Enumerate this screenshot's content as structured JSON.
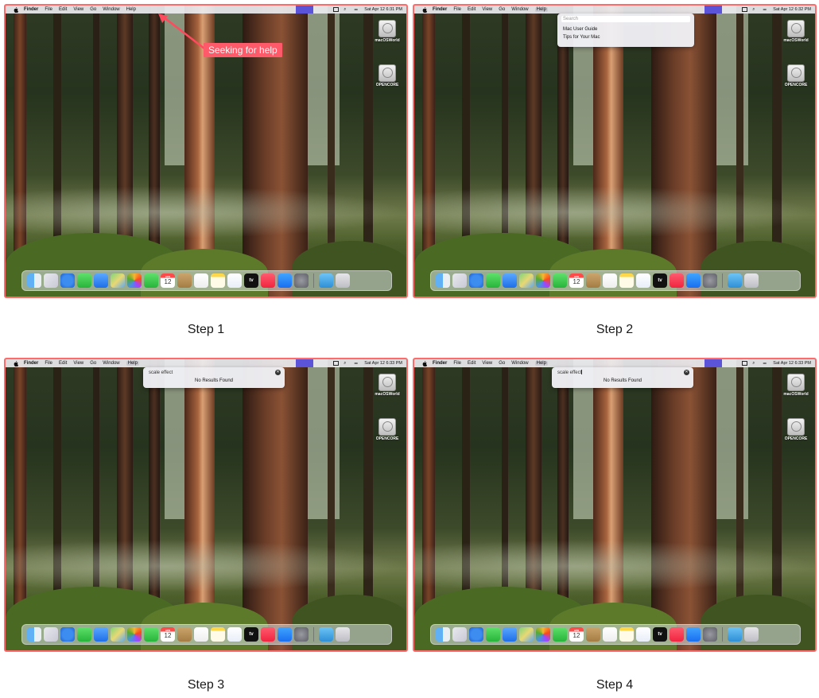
{
  "menubar": {
    "app": "Finder",
    "items": [
      "File",
      "Edit",
      "View",
      "Go",
      "Window",
      "Help"
    ]
  },
  "clock": {
    "step1": "Sat Apr 12  6:31 PM",
    "step2": "Sat Apr 12  6:32 PM",
    "step3": "Sat Apr 12  6:33 PM",
    "step4": "Sat Apr 12  6:33 PM"
  },
  "desktop_icons": [
    "macOSWorld",
    "OPENCORE"
  ],
  "annotation": "Seeking for help",
  "help_menu": {
    "search_placeholder": "Search",
    "items": [
      "Mac User Guide",
      "Tips for Your Mac"
    ],
    "query": "scale effect",
    "no_results": "No Results Found"
  },
  "dock": {
    "icons": [
      "finder-icon",
      "launchpad-icon",
      "safari-icon",
      "messages-icon",
      "mail-icon",
      "maps-icon",
      "photos-icon",
      "facetime-icon",
      "calendar-icon",
      "contacts-icon",
      "reminders-icon",
      "notes-icon",
      "freeform-icon",
      "tv-icon",
      "music-icon",
      "app-store-icon",
      "system-settings-icon",
      "downloads-icon",
      "trash-icon"
    ],
    "calendar_month": "APR",
    "calendar_day": "12",
    "tv_label": "tv"
  },
  "step_labels": [
    "Step 1",
    "Step 2",
    "Step 3",
    "Step 4"
  ]
}
